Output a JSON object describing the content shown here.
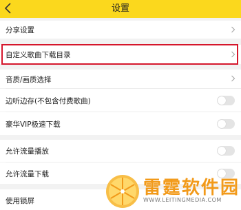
{
  "header": {
    "title": "设置",
    "background_color": "#fbd81d"
  },
  "settings": {
    "share": {
      "label": "分享设置"
    },
    "custom_download_dir": {
      "label": "自定义歌曲下载目录",
      "highlighted": true,
      "highlight_color": "#d5162b"
    },
    "quality": {
      "label": "音质/画质选择"
    },
    "cache_while_listening": {
      "label": "边听边存(不包含付费歌曲)",
      "enabled": false
    },
    "vip_fast_download": {
      "label": "豪华VIP极速下载",
      "enabled": false
    },
    "allow_stream_play": {
      "label": "允许流量播放",
      "enabled": false
    },
    "allow_stream_download": {
      "label": "允许流量下载",
      "enabled": false
    },
    "lockscreen": {
      "label": "使用锁屏"
    }
  },
  "watermark": {
    "name": "雷霆软件园",
    "url": "WWW.LEITINGMEDIA.COM",
    "color": "#f29a1a"
  }
}
